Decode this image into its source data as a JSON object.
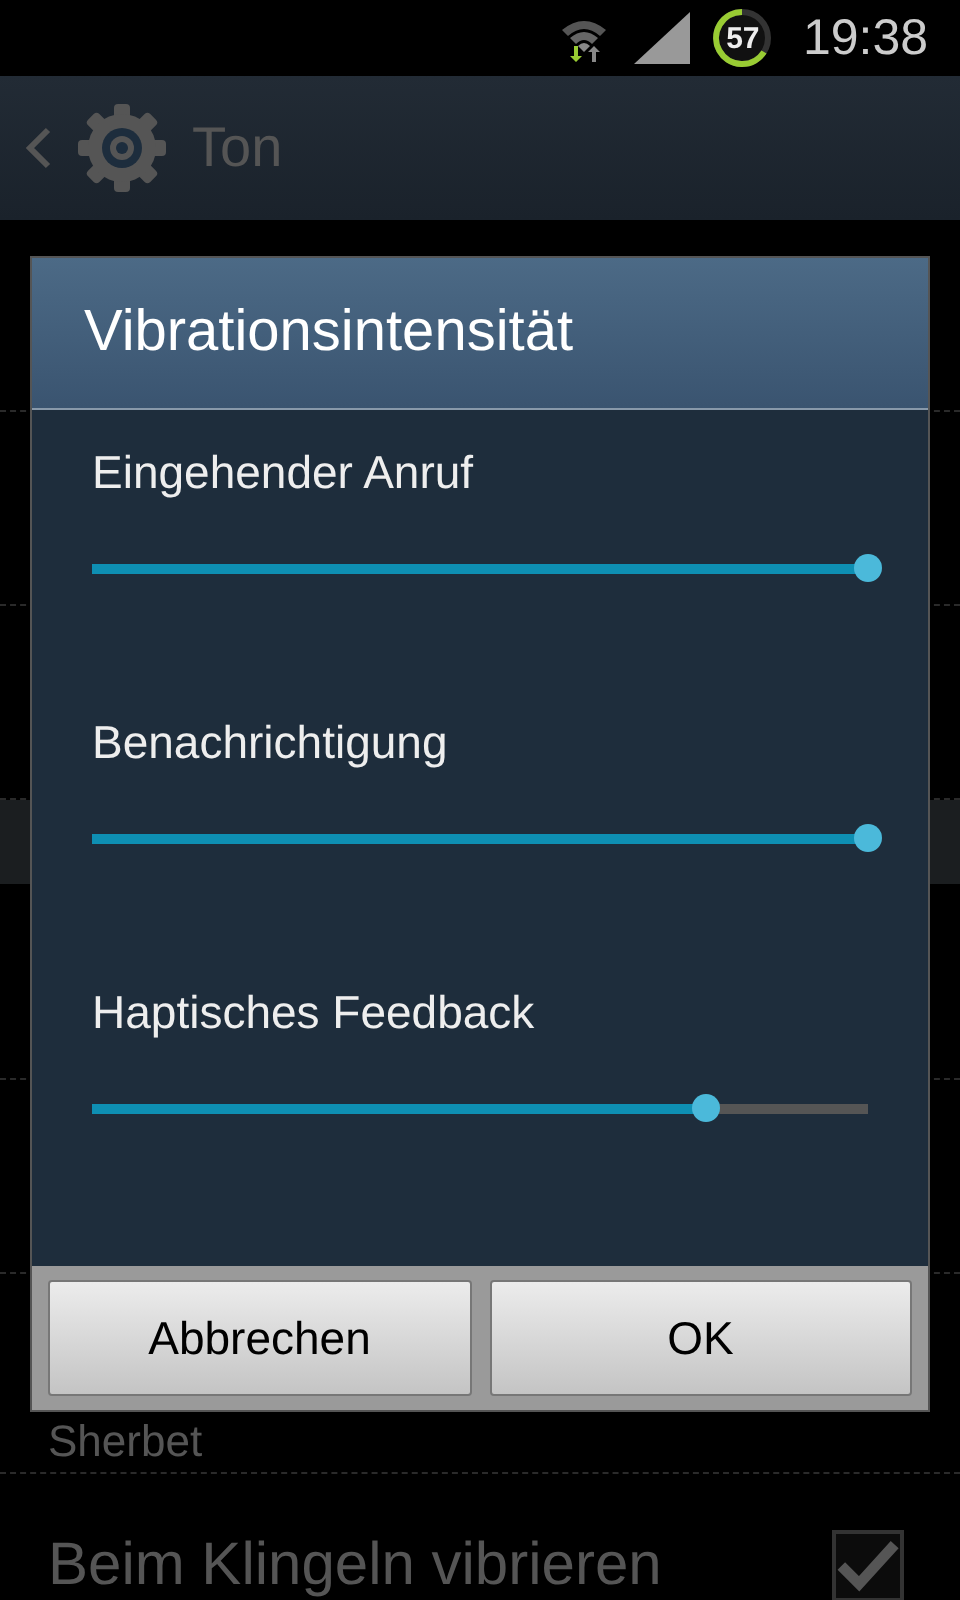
{
  "status_bar": {
    "battery": "57",
    "time": "19:38"
  },
  "action_bar": {
    "title": "Ton"
  },
  "list": {
    "items": [
      {
        "kind": "subtitle",
        "text": "Sherbet"
      },
      {
        "kind": "checkbox",
        "label": "Beim Klingeln vibrieren",
        "checked": true
      }
    ]
  },
  "dialog": {
    "title": "Vibrationsintensität",
    "sliders": [
      {
        "label": "Eingehender Anruf",
        "level": 1.0
      },
      {
        "label": "Benachrichtigung",
        "level": 1.0
      },
      {
        "label": "Haptisches Feedback",
        "level": 0.79
      }
    ],
    "buttons": [
      "Abbrechen",
      "OK"
    ]
  }
}
